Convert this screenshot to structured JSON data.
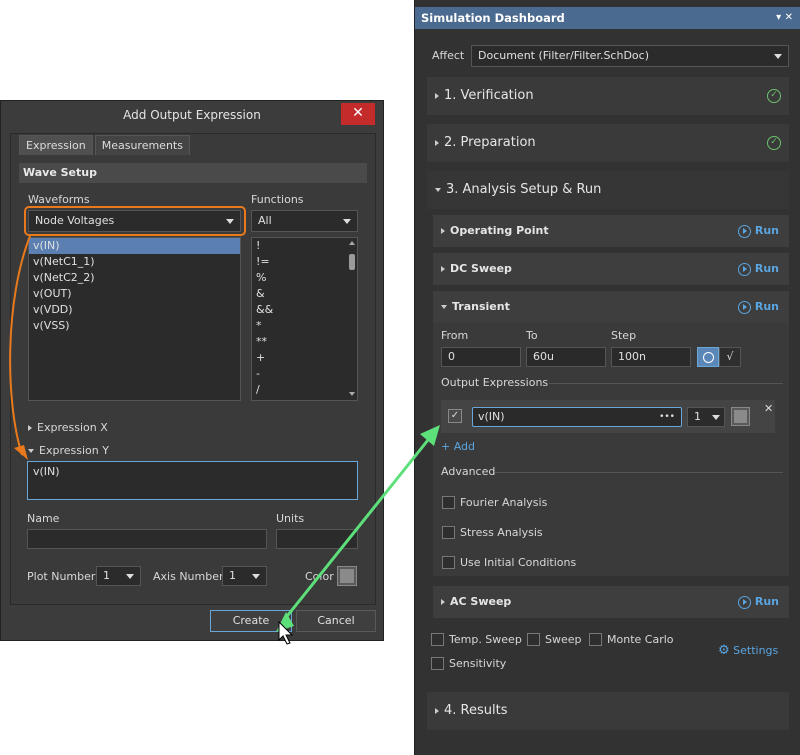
{
  "dialog": {
    "title": "Add Output Expression",
    "close_glyph": "✕",
    "tabs": [
      "Expression",
      "Measurements"
    ],
    "section": "Wave Setup",
    "waveforms_label": "Waveforms",
    "waveforms_value": "Node Voltages",
    "functions_label": "Functions",
    "functions_value": "All",
    "waveforms": [
      "v(IN)",
      "v(NetC1_1)",
      "v(NetC2_2)",
      "v(OUT)",
      "v(VDD)",
      "v(VSS)"
    ],
    "functions": [
      "!",
      "!=",
      "%",
      "&",
      "&&",
      "*",
      "**",
      "+",
      "-",
      "/"
    ],
    "expression_x": "Expression X",
    "expression_y": "Expression Y",
    "expression_y_value": "v(IN)",
    "name_label": "Name",
    "units_label": "Units",
    "plot_number_label": "Plot Number",
    "plot_number_value": "1",
    "axis_number_label": "Axis Number",
    "axis_number_value": "1",
    "color_label": "Color",
    "create": "Create",
    "cancel": "Cancel"
  },
  "panel": {
    "title": "Simulation Dashboard",
    "title_icons": "▾ ✕",
    "affect_label": "Affect",
    "affect_value": "Document (Filter/Filter.SchDoc)",
    "sections": {
      "verification": "1. Verification",
      "preparation": "2. Preparation",
      "analysis": "3. Analysis Setup & Run",
      "results": "4. Results"
    },
    "analyses": {
      "operating_point": "Operating Point",
      "dc_sweep": "DC Sweep",
      "transient": "Transient",
      "ac_sweep": "AC Sweep",
      "run": "Run"
    },
    "transient": {
      "from_label": "From",
      "from_value": "0",
      "to_label": "To",
      "to_value": "60u",
      "step_label": "Step",
      "step_value": "100n",
      "output_expressions": "Output Expressions",
      "expr_value": "v(IN)",
      "expr_dots": "•••",
      "expr_plot": "1",
      "remove": "✕",
      "add": "+ Add",
      "advanced": "Advanced",
      "fourier": "Fourier Analysis",
      "stress": "Stress Analysis",
      "initial": "Use Initial Conditions"
    },
    "footer": {
      "temp_sweep": "Temp. Sweep",
      "sweep": "Sweep",
      "monte_carlo": "Monte Carlo",
      "sensitivity": "Sensitivity",
      "settings": "Settings"
    }
  },
  "colors": {
    "accent": "#5aa5e0",
    "highlight": "#e8791c",
    "arrow": "#5de07a",
    "ok": "#6cc36c"
  }
}
